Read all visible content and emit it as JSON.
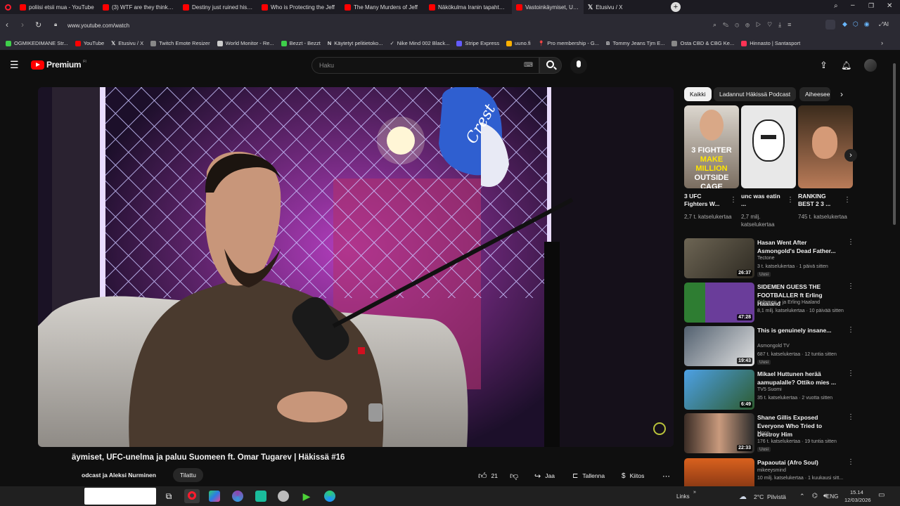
{
  "tabs": [
    {
      "title": "poliisi etsii mua - YouTube",
      "color": "#ff0000"
    },
    {
      "title": "(3) WTF are they thinking? -",
      "color": "#ff0000"
    },
    {
      "title": "Destiny just ruined his car",
      "color": "#ff0000"
    },
    {
      "title": "Who is Protecting the Jeff",
      "color": "#ff0000"
    },
    {
      "title": "The Many Murders of Jeff",
      "color": "#ff0000"
    },
    {
      "title": "Näkökulma Iranin tapahtuma",
      "color": "#ff0000"
    },
    {
      "title": "Vastoinkäymiset, UFC",
      "color": "#ff0000"
    },
    {
      "title": "Etusivu / X",
      "color": "#ffffff"
    }
  ],
  "address": {
    "url": "www.youtube.com/watch"
  },
  "bookmarks": [
    {
      "label": "OGMIKEDIMANE Str...",
      "color": "#3ecf4a"
    },
    {
      "label": "YouTube",
      "color": "#ff0000"
    },
    {
      "label": "Etusivu / X",
      "color": "#ffffff"
    },
    {
      "label": "Twitch Emote Resizer",
      "color": "#888888"
    },
    {
      "label": "World Monitor - Re...",
      "color": "#cccccc"
    },
    {
      "label": "Bezzt - Bezzt",
      "color": "#3ecf4a"
    },
    {
      "label": "Käytetyt pelitietoko...",
      "color": "#ffffff"
    },
    {
      "label": "Nike Mind 002 Black...",
      "color": "#ffffff"
    },
    {
      "label": "Stripe Express",
      "color": "#635bff"
    },
    {
      "label": "uuno.fi",
      "color": "#ffb000"
    },
    {
      "label": "Pro membership - G...",
      "color": "#ff4444"
    },
    {
      "label": "Tommy Jeans Tjm E...",
      "color": "#ffffff"
    },
    {
      "label": "Osta CBD & CBG Ke...",
      "color": "#888888"
    },
    {
      "label": "Hinnasto | Santasport",
      "color": "#ff3355"
    }
  ],
  "youtube": {
    "logo": "Premium",
    "logo_sup": "FI",
    "search_placeholder": "Haku"
  },
  "video": {
    "title_fragment": "äymiset, UFC-unelma ja paluu Suomeen ft. Omar Tugarev | Häkissä #16",
    "channel_fragment": "odcast ja Aleksi Nurminen",
    "subscribe_label": "Tilattu",
    "likes": "21",
    "share_label": "Jaa",
    "save_label": "Tallenna",
    "thanks_label": "Kiitos",
    "brand": "Crest"
  },
  "chips": [
    "Kaikki",
    "Ladannut Häkissä Podcast",
    "Aiheeseen"
  ],
  "shorts": [
    {
      "title": "3 UFC Fighters W...",
      "views": "2,7 t. katselukertaa",
      "overlay": [
        "3 FIGHTER",
        "MAKE MILLION",
        "OUTSIDE CAGE"
      ]
    },
    {
      "title": "unc was eatin ...",
      "views": "2,7 milj. katselukertaa",
      "overlay": []
    },
    {
      "title": "RANKING BEST 2 3 ...",
      "views": "745 t. katselukertaa",
      "overlay": []
    }
  ],
  "recommended": [
    {
      "title": "Hasan Went After Asmongold's Dead Father...",
      "channel": "Tectone",
      "meta": "3 t. katselukertaa · 1 päivä sitten",
      "duration": "26:37",
      "new": "Uusi",
      "thumb": "#4a4235"
    },
    {
      "title": "SIDEMEN GUESS THE FOOTBALLER ft Erling Haaland",
      "channel": "Sidemen ● ja Erling Haaland",
      "meta": "8,1 milj. katselukertaa · 10 päivää sitten",
      "duration": "47:28",
      "new": "",
      "thumb": "#5a3f7a"
    },
    {
      "title": "This is genuinely insane...",
      "channel": "Asmongold TV",
      "meta": "687 t. katselukertaa · 12 tuntia sitten",
      "duration": "19:43",
      "new": "Uusi",
      "thumb": "#3b4a5c"
    },
    {
      "title": "Mikael Huttunen herää aamupalalle? Ottiko mies ...",
      "channel": "TV5 Suomi",
      "meta": "35 t. katselukertaa · 2 vuotta sitten",
      "duration": "6:49",
      "new": "",
      "thumb": "#3f78b5"
    },
    {
      "title": "Shane Gillis Exposed Everyone Who Tried to Destroy Him",
      "channel": "Moon",
      "meta": "176 t. katselukertaa · 19 tuntia sitten",
      "duration": "22:33",
      "new": "Uusi",
      "thumb": "#262626"
    },
    {
      "title": "Papaoutai (Afro Soul)",
      "channel": "mikeeysmind",
      "meta": "10 milj. katselukertaa · 1 kuukausi sitt...",
      "duration": "",
      "new": "",
      "thumb": "#c84d1b"
    }
  ],
  "taskbar": {
    "links_label": "Links",
    "weather": "2°C  Pilvistä",
    "lang": "ENG",
    "time": "15.14",
    "date": "12/03/2026"
  }
}
